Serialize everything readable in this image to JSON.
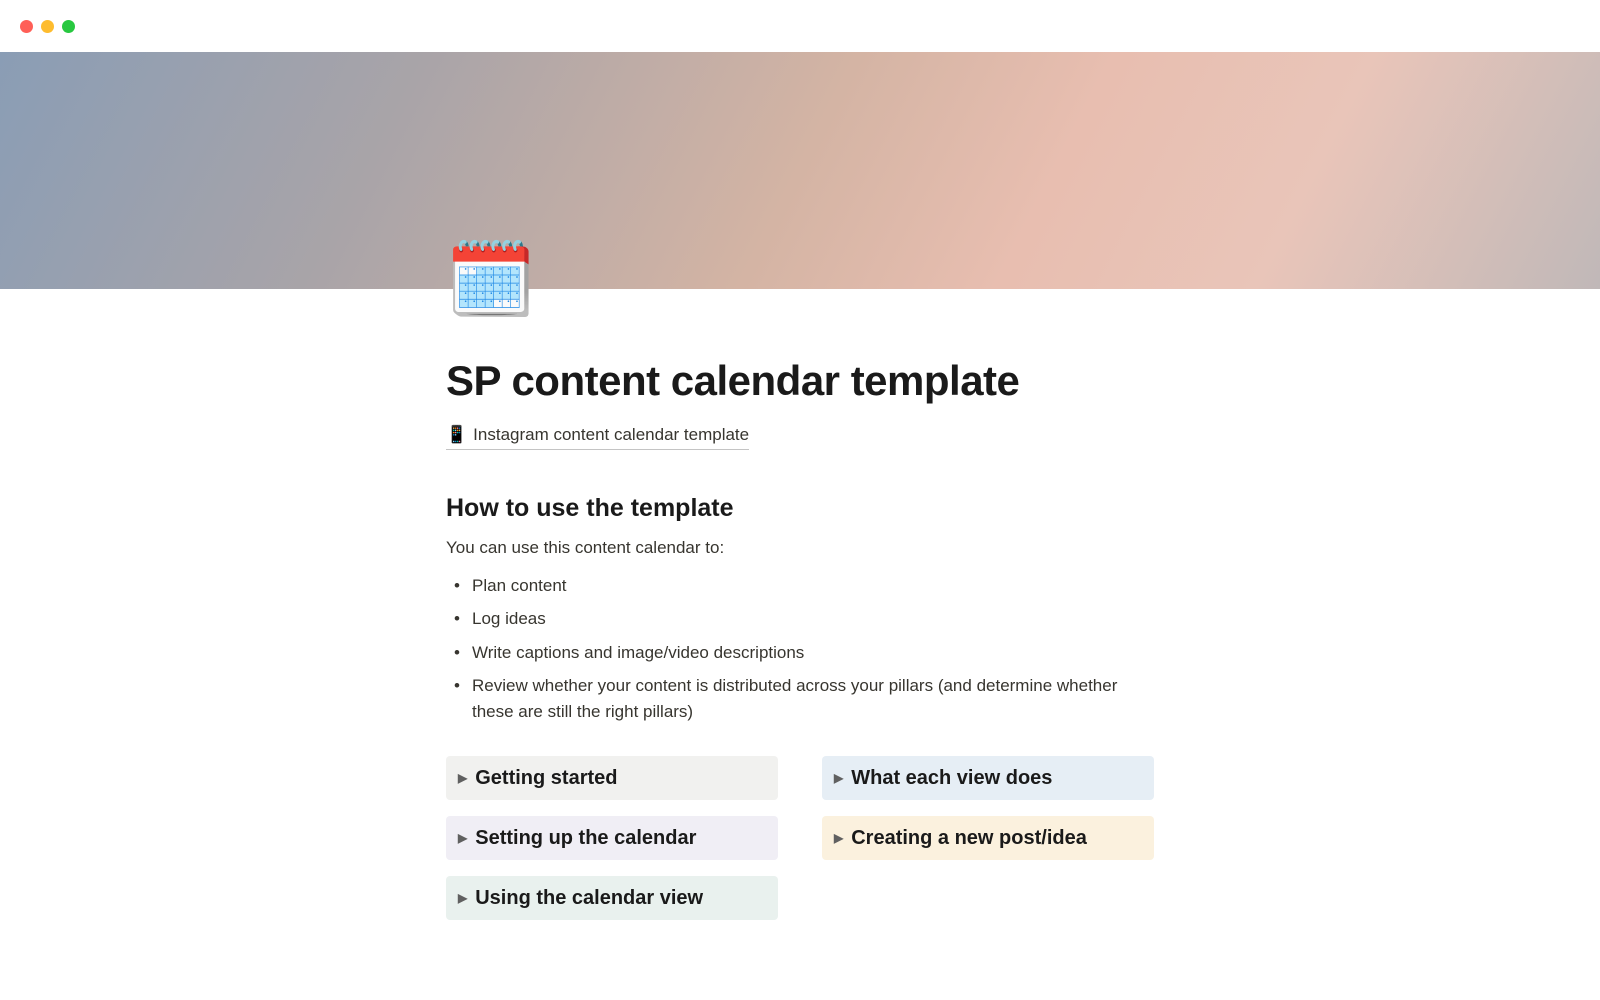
{
  "page": {
    "title": "SP content calendar template",
    "icon": "🗓️"
  },
  "sublink": {
    "icon": "📱",
    "text": "Instagram content calendar template"
  },
  "section": {
    "heading": "How to use the template",
    "intro": "You can use this content calendar to:"
  },
  "bullets": [
    "Plan content",
    "Log ideas",
    "Write captions and image/video descriptions",
    "Review whether your content is distributed across your pillars (and determine whether these are still the right pillars)"
  ],
  "toggles": {
    "left": [
      {
        "label": "Getting started",
        "bgClass": "bg-gray"
      },
      {
        "label": "Setting up the calendar",
        "bgClass": "bg-purple"
      },
      {
        "label": "Using the calendar view",
        "bgClass": "bg-teal"
      }
    ],
    "right": [
      {
        "label": "What each view does",
        "bgClass": "bg-blue"
      },
      {
        "label": "Creating a new post/idea",
        "bgClass": "bg-yellow"
      }
    ]
  }
}
